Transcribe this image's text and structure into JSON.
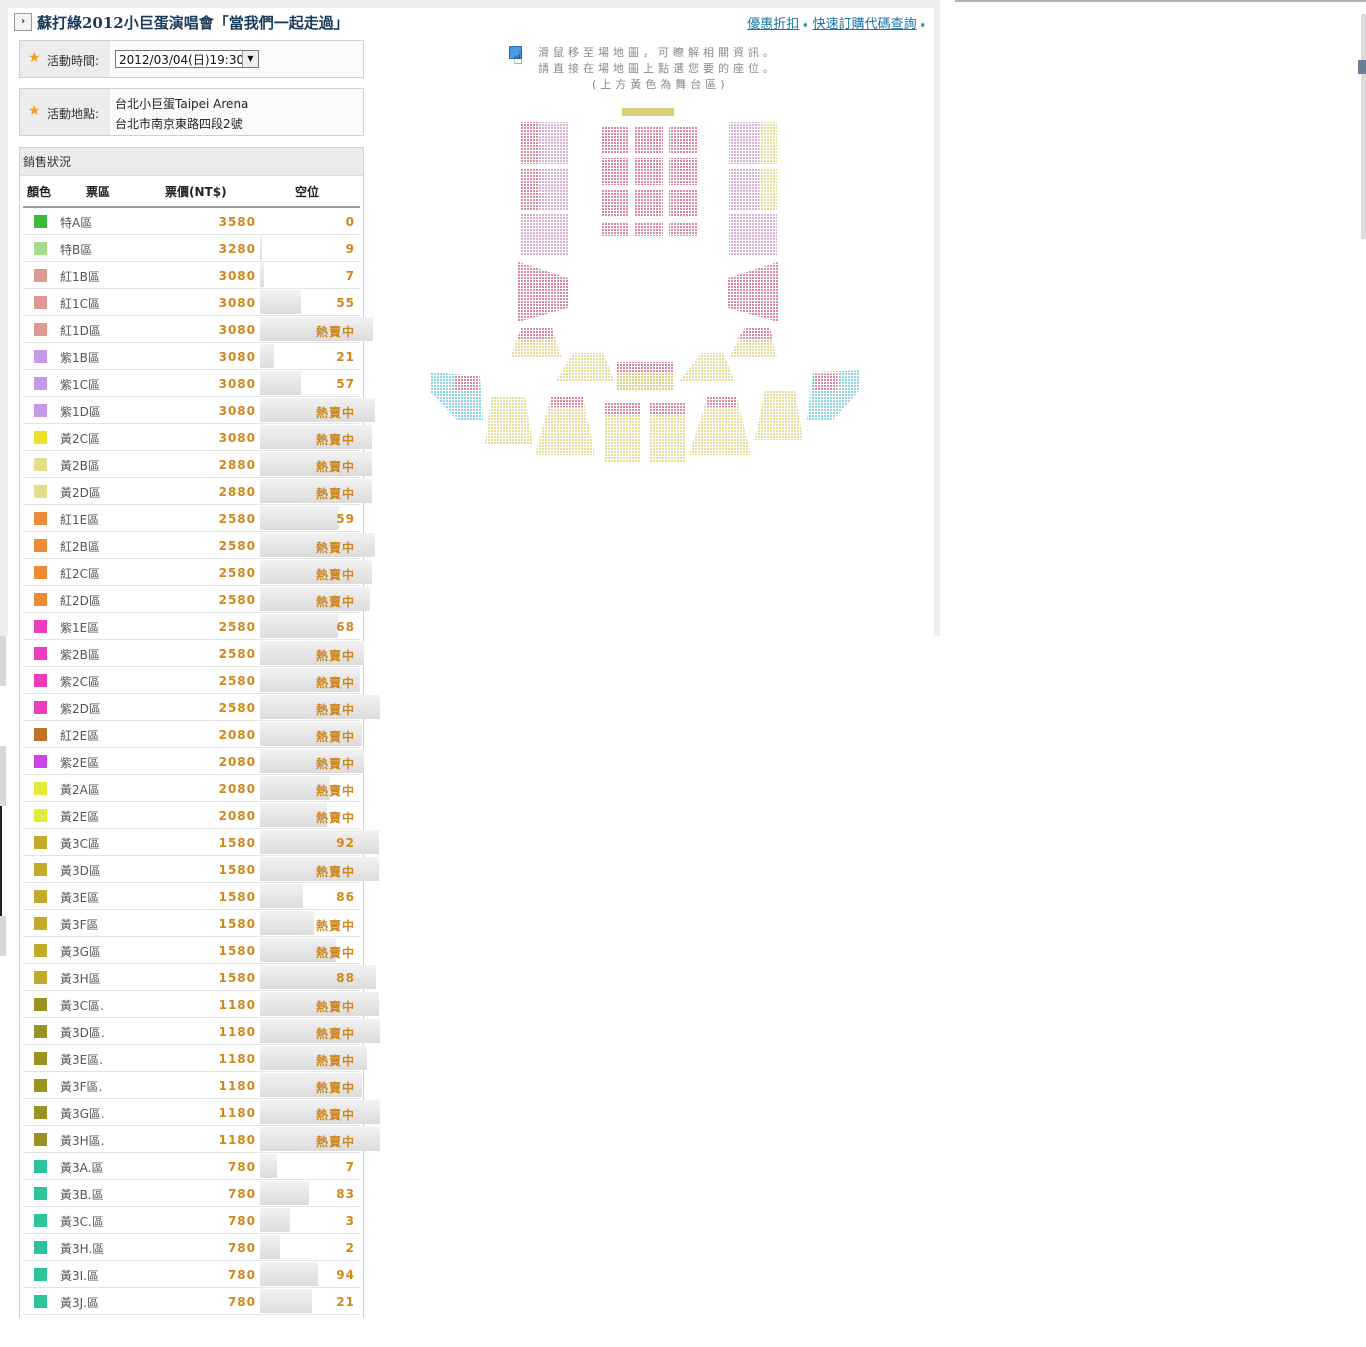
{
  "page": {
    "title": "蘇打綠2012小巨蛋演唱會「當我們一起走過」",
    "links": [
      {
        "label": "優惠折扣"
      },
      {
        "label": "快速訂購代碼查詢"
      }
    ]
  },
  "event": {
    "time_label": "活動時間:",
    "date_value": "2012/03/04(日)19:30",
    "place_label": "活動地點:",
    "venue": "台北小巨蛋Taipei Arena",
    "address": "台北市南京東路四段2號"
  },
  "sales": {
    "header": "銷售狀況",
    "columns": {
      "color": "顏色",
      "zone": "票區",
      "price": "票價(NT$)",
      "seats": "空位"
    },
    "rows": [
      {
        "color": "#3cb83c",
        "zone": "特A區",
        "price": "3580",
        "status": "0",
        "fill": 0.0
      },
      {
        "color": "#a6dc8a",
        "zone": "特B區",
        "price": "3280",
        "status": "9",
        "fill": 0.02
      },
      {
        "color": "#dd9a94",
        "zone": "紅1B區",
        "price": "3080",
        "status": "7",
        "fill": 0.03
      },
      {
        "color": "#dd9a94",
        "zone": "紅1C區",
        "price": "3080",
        "status": "55",
        "fill": 0.34
      },
      {
        "color": "#dd9a94",
        "zone": "紅1D區",
        "price": "3080",
        "status": "熱賣中",
        "fill": 0.94
      },
      {
        "color": "#c49ae6",
        "zone": "紫1B區",
        "price": "3080",
        "status": "21",
        "fill": 0.12
      },
      {
        "color": "#c49ae6",
        "zone": "紫1C區",
        "price": "3080",
        "status": "57",
        "fill": 0.34
      },
      {
        "color": "#c49ae6",
        "zone": "紫1D區",
        "price": "3080",
        "status": "熱賣中",
        "fill": 0.96
      },
      {
        "color": "#ede030",
        "zone": "黃2C區",
        "price": "3080",
        "status": "熱賣中",
        "fill": 0.93
      },
      {
        "color": "#e6dc8e",
        "zone": "黃2B區",
        "price": "2880",
        "status": "熱賣中",
        "fill": 0.93
      },
      {
        "color": "#e6dc8e",
        "zone": "黃2D區",
        "price": "2880",
        "status": "熱賣中",
        "fill": 0.93
      },
      {
        "color": "#ec8a36",
        "zone": "紅1E區",
        "price": "2580",
        "status": "59",
        "fill": 0.66
      },
      {
        "color": "#ec8a36",
        "zone": "紅2B區",
        "price": "2580",
        "status": "熱賣中",
        "fill": 0.96
      },
      {
        "color": "#ec8a36",
        "zone": "紅2C區",
        "price": "2580",
        "status": "熱賣中",
        "fill": 0.93
      },
      {
        "color": "#ec8a36",
        "zone": "紅2D區",
        "price": "2580",
        "status": "熱賣中",
        "fill": 0.92
      },
      {
        "color": "#ee3cbe",
        "zone": "紫1E區",
        "price": "2580",
        "status": "68",
        "fill": 0.65
      },
      {
        "color": "#ee3cbe",
        "zone": "紫2B區",
        "price": "2580",
        "status": "熱賣中",
        "fill": 0.87
      },
      {
        "color": "#ee3cbe",
        "zone": "紫2C區",
        "price": "2580",
        "status": "熱賣中",
        "fill": 0.83
      },
      {
        "color": "#ee3cbe",
        "zone": "紫2D區",
        "price": "2580",
        "status": "熱賣中",
        "fill": 1.0
      },
      {
        "color": "#c0742a",
        "zone": "紅2E區",
        "price": "2080",
        "status": "熱賣中",
        "fill": 0.85
      },
      {
        "color": "#cc44e6",
        "zone": "紫2E區",
        "price": "2080",
        "status": "熱賣中",
        "fill": 0.87
      },
      {
        "color": "#e2ea3c",
        "zone": "黃2A區",
        "price": "2080",
        "status": "熱賣中",
        "fill": 0.58
      },
      {
        "color": "#e2ea3c",
        "zone": "黃2E區",
        "price": "2080",
        "status": "熱賣中",
        "fill": 0.56
      },
      {
        "color": "#c2aa2c",
        "zone": "黃3C區",
        "price": "1580",
        "status": "92",
        "fill": 0.99
      },
      {
        "color": "#c2aa2c",
        "zone": "黃3D區",
        "price": "1580",
        "status": "熱賣中",
        "fill": 0.99
      },
      {
        "color": "#c2aa2c",
        "zone": "黃3E區",
        "price": "1580",
        "status": "86",
        "fill": 0.36
      },
      {
        "color": "#c2aa2c",
        "zone": "黃3F區",
        "price": "1580",
        "status": "熱賣中",
        "fill": 0.45
      },
      {
        "color": "#c2aa2c",
        "zone": "黃3G區",
        "price": "1580",
        "status": "熱賣中",
        "fill": 0.63
      },
      {
        "color": "#c2aa2c",
        "zone": "黃3H區",
        "price": "1580",
        "status": "88",
        "fill": 0.97
      },
      {
        "color": "#9a9222",
        "zone": "黃3C區.",
        "price": "1180",
        "status": "熱賣中",
        "fill": 0.99
      },
      {
        "color": "#9a9222",
        "zone": "黃3D區.",
        "price": "1180",
        "status": "熱賣中",
        "fill": 1.0
      },
      {
        "color": "#9a9222",
        "zone": "黃3E區.",
        "price": "1180",
        "status": "熱賣中",
        "fill": 0.89
      },
      {
        "color": "#9a9222",
        "zone": "黃3F區.",
        "price": "1180",
        "status": "熱賣中",
        "fill": 0.85
      },
      {
        "color": "#9a9222",
        "zone": "黃3G區.",
        "price": "1180",
        "status": "熱賣中",
        "fill": 1.0
      },
      {
        "color": "#9a9222",
        "zone": "黃3H區.",
        "price": "1180",
        "status": "熱賣中",
        "fill": 1.0
      },
      {
        "color": "#2cc49a",
        "zone": "黃3A.區",
        "price": "780",
        "status": "7",
        "fill": 0.14
      },
      {
        "color": "#2cc49a",
        "zone": "黃3B.區",
        "price": "780",
        "status": "83",
        "fill": 0.41
      },
      {
        "color": "#2cc49a",
        "zone": "黃3C.區",
        "price": "780",
        "status": "3",
        "fill": 0.25
      },
      {
        "color": "#2cc49a",
        "zone": "黃3H.區",
        "price": "780",
        "status": "2",
        "fill": 0.17
      },
      {
        "color": "#2cc49a",
        "zone": "黃3I.區",
        "price": "780",
        "status": "94",
        "fill": 0.48
      },
      {
        "color": "#2cc49a",
        "zone": "黃3J.區",
        "price": "780",
        "status": "21",
        "fill": 0.43
      }
    ]
  },
  "seatmap": {
    "hint_lines": [
      "滑鼠移至場地圖，可瞭解相關資訊。",
      "請直接在場地圖上點選您要的座位。",
      "(上方黃色為舞台區)"
    ],
    "colors": {
      "stage": "#d8cf7c",
      "pink": "#d9b3d6",
      "rose": "#d88aa0",
      "yellow": "#e6dd9a",
      "yellow2": "#ddd088",
      "cyan": "#8fd4df"
    }
  }
}
